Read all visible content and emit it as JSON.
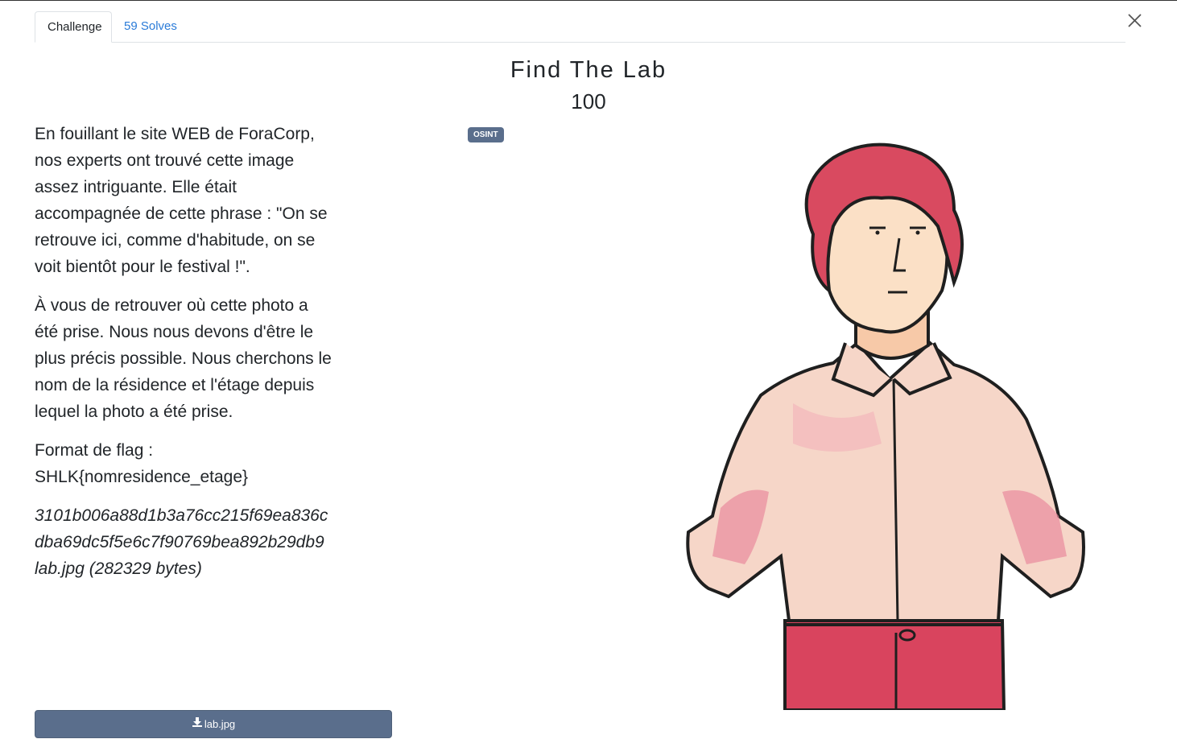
{
  "tabs": {
    "challenge_label": "Challenge",
    "solves_label": "59 Solves"
  },
  "challenge": {
    "title": "Find The Lab",
    "points": "100",
    "category_badge": "OSINT",
    "description": [
      "En fouillant le site WEB de ForaCorp, nos experts ont trouvé cette image assez intriguante. Elle était accompagnée de cette phrase : \"On se retrouve ici, comme d'habitude, on se voit bientôt pour le festival !\".",
      "À vous de retrouver où cette photo a été prise. Nous nous devons d'être le plus précis possible. Nous cherchons le nom de la résidence et l'étage depuis lequel la photo a été prise.",
      "Format de flag : SHLK{nomresidence_etage}"
    ],
    "file_hash_line": "3101b006a88d1b3a76cc215f69ea836cdba69dc5f5e6c7f90769bea892b29db9 lab.jpg (282329 bytes)"
  },
  "download": {
    "label": "lab.jpg",
    "icon": "download-icon"
  },
  "colors": {
    "badge_bg": "#5a6e8c",
    "link": "#2a7bd8",
    "button_bg": "#5a6e8c"
  }
}
